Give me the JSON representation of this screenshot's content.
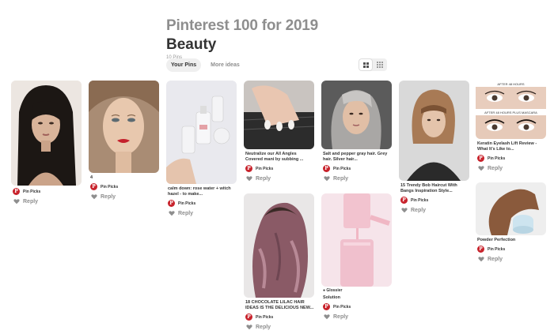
{
  "board": {
    "collection_title": "Pinterest 100 for 2019",
    "name": "Beauty",
    "pin_count": "10 Pins"
  },
  "tabs": [
    {
      "label": "Your Pins",
      "active": true
    },
    {
      "label": "More ideas",
      "active": false
    }
  ],
  "view_toggle": {
    "selected": "grid-2"
  },
  "reply_label": "Reply",
  "pins": [
    {
      "desc": "",
      "source": "",
      "user": "Pin Picks"
    },
    {
      "desc": "4",
      "source": "",
      "user": "Pin Picks"
    },
    {
      "desc": "calm down: rose water + witch hazel - to make...",
      "source": "",
      "user": "Pin Picks"
    },
    {
      "desc": "Neutralize our All Angles Covered mani by subbing ...",
      "source": "",
      "user": "Pin Picks"
    },
    {
      "desc": "Salt and pepper gray hair. Grey hair. Silver hair...",
      "source": "",
      "user": "Pin Picks"
    },
    {
      "desc": "15 Trendy Bob Haircut With Bangs Inspiration Style...",
      "source": "",
      "user": "Pin Picks"
    },
    {
      "desc": "Keratin Eyelash Lift Review - What It's Like to...",
      "source": "",
      "user": "Pin Picks",
      "image_text": [
        "AFTER 48 HOURS",
        "AFTER 48 HOURS PLUS MASCARA"
      ]
    },
    {
      "desc": "18 CHOCOLATE LILAC HAIR IDEAS IS THE DELICIOUS NEW...",
      "source": "",
      "user": "Pin Picks"
    },
    {
      "desc": "Solution",
      "source": "Glossier",
      "user": "Pin Picks"
    },
    {
      "desc": "Powder Perfection",
      "source": "",
      "user": "Pin Picks"
    }
  ],
  "colors": {
    "pinterest_red": "#c8232c",
    "muted_text": "#8e8e8e"
  }
}
